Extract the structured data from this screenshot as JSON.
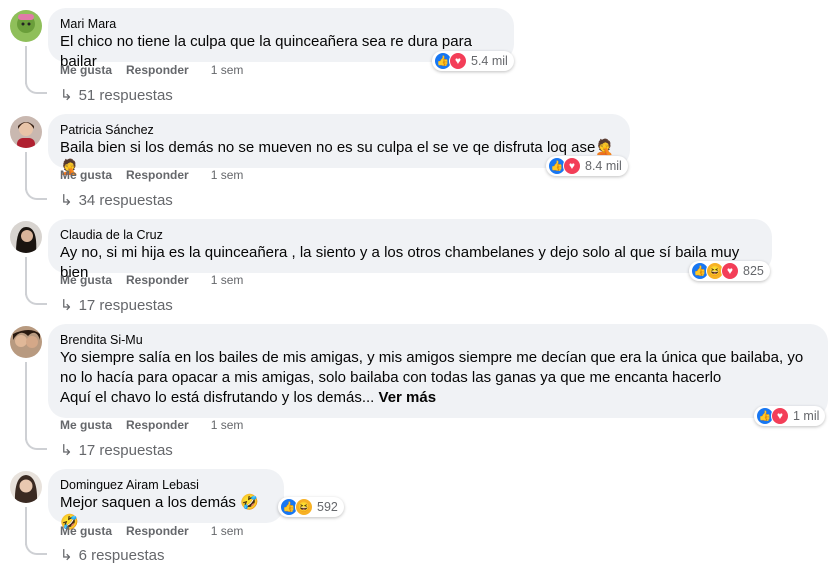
{
  "comments": [
    {
      "author": "Mari Mara",
      "text": "El chico no tiene la culpa que la quinceañera sea re dura para bailar",
      "reactions": "5.4 mil",
      "like_label": "Me gusta",
      "reply_label": "Responder",
      "time": "1 sem",
      "replies": "51 respuestas"
    },
    {
      "author": "Patricia Sánchez",
      "text": "Baila bien si los demás no se mueven no es su culpa el se ve qe disfruta loq ase🤦🤦",
      "reactions": "8.4 mil",
      "like_label": "Me gusta",
      "reply_label": "Responder",
      "time": "1 sem",
      "replies": "34 respuestas"
    },
    {
      "author": "Claudia de la Cruz",
      "text": "Ay no, si mi hija es la quinceañera , la siento y a los otros chambelanes y dejo solo al que sí baila muy bien",
      "reactions": "825",
      "like_label": "Me gusta",
      "reply_label": "Responder",
      "time": "1 sem",
      "replies": "17 respuestas"
    },
    {
      "author": "Brendita Si-Mu",
      "text": "Yo siempre salía en los bailes de mis amigas, y mis amigos siempre me decían que era la única que bailaba, yo no lo hacía para opacar a mis amigas, solo bailaba con todas las ganas ya que me encanta hacerlo\nAquí el chavo lo está disfrutando y los demás...",
      "see_more": "Ver más",
      "reactions": "1 mil",
      "like_label": "Me gusta",
      "reply_label": "Responder",
      "time": "1 sem",
      "replies": "17 respuestas"
    },
    {
      "author": "Dominguez Airam Lebasi",
      "text": "Mejor saquen a los demás 🤣🤣",
      "reactions": "592",
      "like_label": "Me gusta",
      "reply_label": "Responder",
      "time": "1 sem",
      "replies": "6 respuestas"
    }
  ],
  "colors": {
    "bubble": "#f0f2f5",
    "meta": "#65676b",
    "like": "#1877f2",
    "love": "#f33e58",
    "haha": "#f7b125"
  },
  "icons": {
    "like": "thumbs-up-icon",
    "love": "heart-icon",
    "haha": "laughing-face-icon",
    "reply": "reply-arrow-icon"
  }
}
